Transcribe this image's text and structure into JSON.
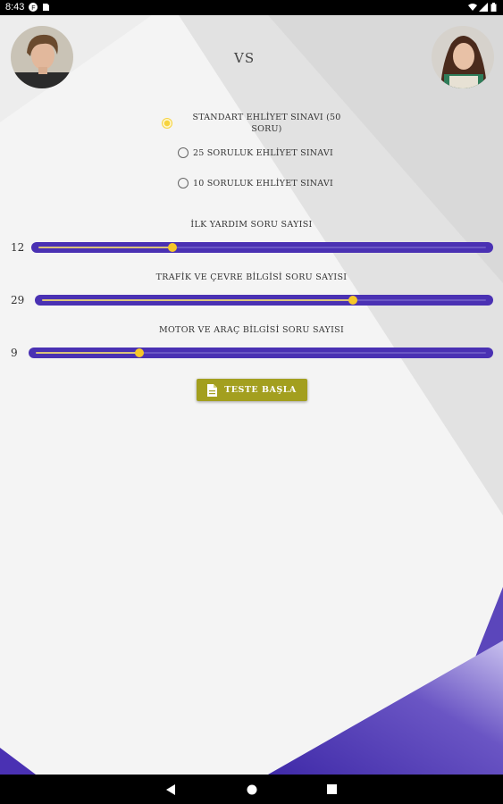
{
  "status_bar": {
    "time": "8:43"
  },
  "header": {
    "vs_label": "VS"
  },
  "exam_options": [
    {
      "label_line1": "STANDART EHLİYET SINAVI (50",
      "label_line2": "SORU)",
      "selected": true
    },
    {
      "label": "25 SORULUK EHLİYET SINAVI",
      "selected": false
    },
    {
      "label": "10 SORULUK EHLİYET SINAVI",
      "selected": false
    }
  ],
  "sliders": [
    {
      "title": "İLK YARDIM SORU SAYISI",
      "value": "12",
      "fraction": 0.3
    },
    {
      "title": "TRAFİK VE ÇEVRE BİLGİSİ SORU SAYISI",
      "value": "29",
      "fraction": 0.7
    },
    {
      "title": "MOTOR VE ARAÇ BİLGİSİ SORU SAYISI",
      "value": "9",
      "fraction": 0.23
    }
  ],
  "start_button": {
    "label": "TESTE BAŞLA",
    "icon": "document-icon"
  },
  "colors": {
    "slider": "#4a31b3",
    "thumb": "#f6c728",
    "button": "#a39f1f",
    "radio_selected": "#f6d33e"
  }
}
